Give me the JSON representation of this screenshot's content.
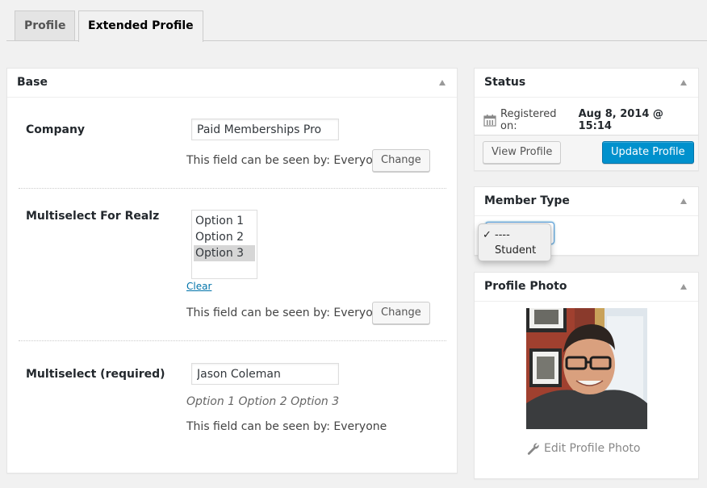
{
  "tabs": [
    {
      "label": "Profile",
      "active": false
    },
    {
      "label": "Extended Profile",
      "active": true
    }
  ],
  "base": {
    "title": "Base",
    "fields": [
      {
        "label": "Company",
        "value": "Paid Memberships Pro",
        "visibility_text": "This field can be seen by: Everyone",
        "change_label": "Change"
      },
      {
        "label": "Multiselect For Realz",
        "options": [
          {
            "label": "Option 1",
            "selected": false
          },
          {
            "label": "Option 2",
            "selected": false
          },
          {
            "label": "Option 3",
            "selected": true
          }
        ],
        "clear_label": "Clear",
        "visibility_text": "This field can be seen by: Everyone",
        "change_label": "Change"
      },
      {
        "label": "Multiselect (required)",
        "value": "Jason Coleman",
        "description": "Option 1 Option 2 Option 3",
        "visibility_text": "This field can be seen by: Everyone"
      }
    ]
  },
  "status": {
    "title": "Status",
    "registered_label": "Registered on:",
    "registered_value": "Aug 8, 2014 @ 15:14",
    "view_profile_label": "View Profile",
    "update_profile_label": "Update Profile",
    "primary_color": "#0091cd"
  },
  "member_type": {
    "title": "Member Type",
    "options": [
      {
        "label": "----",
        "checked": true
      },
      {
        "label": "Student",
        "checked": false
      }
    ],
    "check_glyph": "✓"
  },
  "profile_photo": {
    "title": "Profile Photo",
    "edit_label": "Edit Profile Photo"
  }
}
